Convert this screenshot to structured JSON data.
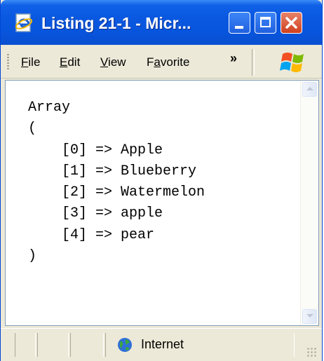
{
  "window": {
    "title": "Listing 21-1 - Micr...",
    "icon": "ie-page-icon",
    "controls": [
      "minimize",
      "maximize",
      "close"
    ]
  },
  "menubar": {
    "file": {
      "accel": "F",
      "rest": "ile"
    },
    "edit": {
      "accel": "E",
      "rest": "dit"
    },
    "view": {
      "accel": "V",
      "rest": "iew"
    },
    "favorites": {
      "pre": "F",
      "accel": "a",
      "rest": "vorite"
    },
    "overflow": "»"
  },
  "content": {
    "output_text": "Array\n(\n    [0] => Apple\n    [1] => Blueberry\n    [2] => Watermelon\n    [3] => apple\n    [4] => pear\n)"
  },
  "statusbar": {
    "zone": "Internet",
    "zone_icon": "globe-icon"
  }
}
